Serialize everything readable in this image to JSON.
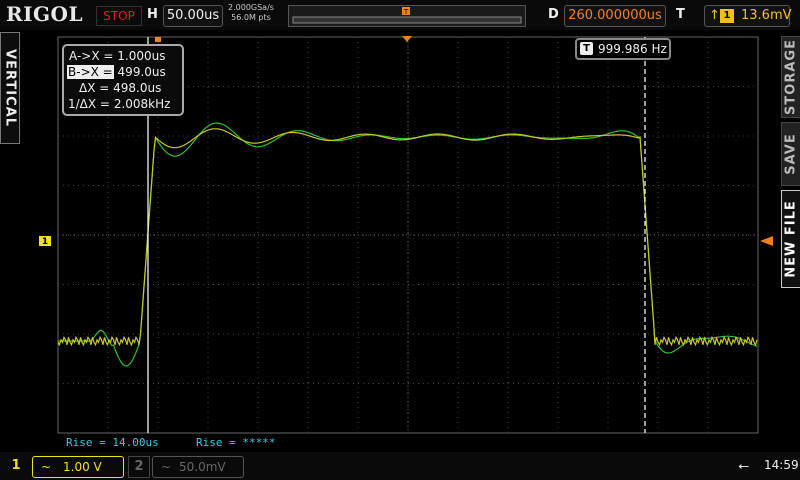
{
  "brand": "RIGOL",
  "run_status": "STOP",
  "timebase": {
    "label": "H",
    "value": "50.00us"
  },
  "acquisition": {
    "sample_rate": "2.000GSa/s",
    "memory_depth": "56.0M pts"
  },
  "delay": {
    "label": "D",
    "value": "260.000000us"
  },
  "trigger": {
    "label": "T",
    "channel": "1",
    "level": "13.6mV",
    "color": "#f0c020"
  },
  "menu_tabs": {
    "left": "VERTICAL",
    "storage": "STORAGE",
    "save": "SAVE",
    "new_file": "NEW FILE"
  },
  "cursor": {
    "a_label": "A->X =",
    "a_value": "1.000us",
    "b_label": "B->X =",
    "b_value": "499.0us",
    "delta_label": "ΔX =",
    "delta_value": "498.0us",
    "inv_label": "1/ΔX =",
    "inv_value": "2.008kHz"
  },
  "frequency_counter": {
    "marker": "T",
    "value": "999.986 Hz"
  },
  "measurements": {
    "rise_ch1": "Rise = 14.00us",
    "rise_ch2": "Rise = *****"
  },
  "channels": [
    {
      "number": "1",
      "coupling": "~",
      "scale": "1.00 V",
      "color": "#f0e020",
      "active": true
    },
    {
      "number": "2",
      "coupling": "~",
      "scale": "50.0mV",
      "color": "#666666",
      "active": false
    }
  ],
  "channel_level_marker": "1",
  "clock": "14:59",
  "colors": {
    "ch1_trace": "#c8c820",
    "ref_trace": "#30c030",
    "grid": "#555555",
    "trigger_marker": "#f08020"
  }
}
